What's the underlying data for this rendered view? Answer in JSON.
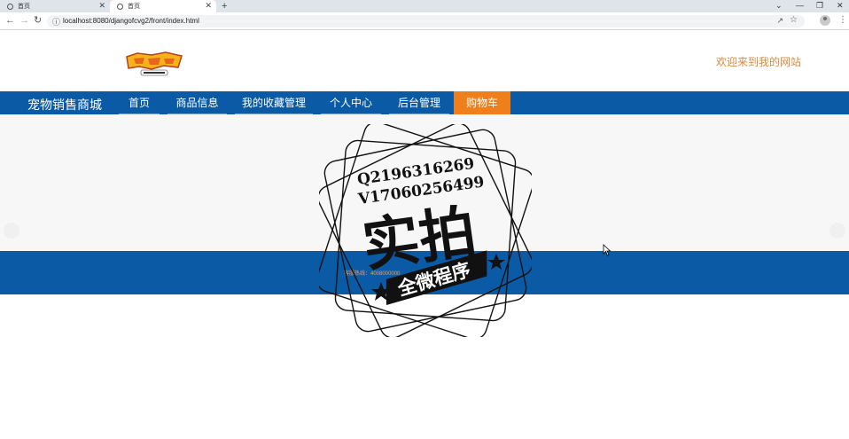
{
  "browser": {
    "tabs": [
      {
        "title": "首页",
        "active": false
      },
      {
        "title": "首页",
        "active": true
      }
    ],
    "new_tab_glyph": "+",
    "url": "localhost:8080/djangofcvg2/front/index.html",
    "controls": {
      "minimize": "—",
      "restore": "❐",
      "close": "✕",
      "tab_list": "⌄"
    }
  },
  "header": {
    "logo_icon": "digimon-adventure-logo",
    "welcome_text": "欢迎来到我的网站"
  },
  "nav": {
    "brand": "宠物销售商城",
    "items": [
      {
        "label": "首页",
        "active": false
      },
      {
        "label": "商品信息",
        "active": false
      },
      {
        "label": "我的收藏管理",
        "active": false
      },
      {
        "label": "个人中心",
        "active": false
      },
      {
        "label": "后台管理",
        "active": false
      },
      {
        "label": "购物车",
        "active": true
      }
    ]
  },
  "footer": {
    "text": "客服热线：4008000000"
  },
  "watermark": {
    "qq": "Q2196316269",
    "phone": "V17060256499",
    "main": "实拍",
    "banner": "全微程序"
  },
  "colors": {
    "nav_bg": "#0b5aa6",
    "nav_active": "#ef7f1a",
    "welcome": "#d98a3d",
    "banner_bg": "#f7f7f7"
  }
}
